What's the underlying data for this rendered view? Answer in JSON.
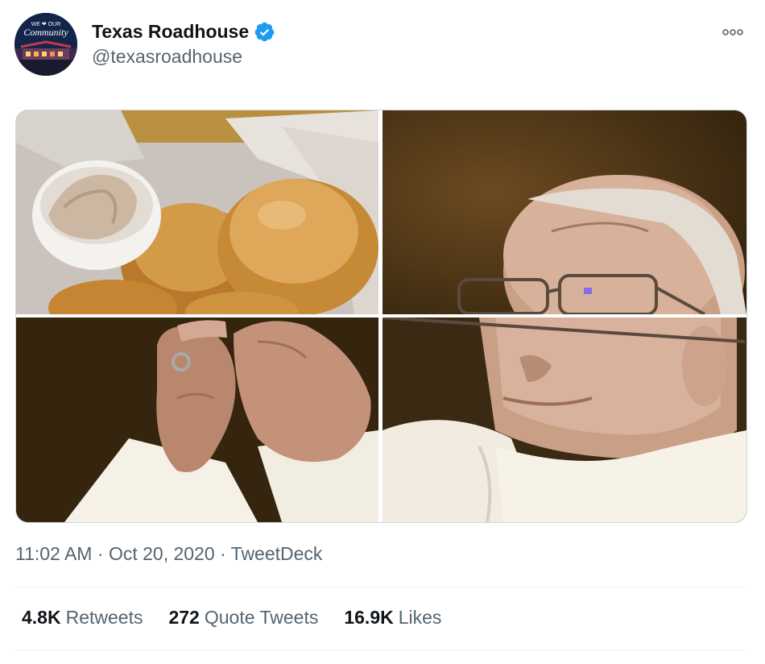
{
  "author": {
    "display_name": "Texas Roadhouse",
    "handle": "@texasroadhouse",
    "verified": true,
    "avatar_text_top": "WE ❤ OUR",
    "avatar_text": "Community"
  },
  "media": [
    {
      "subject": "bread-rolls-with-cinnamon-butter"
    },
    {
      "subject": "pope-upper-face"
    },
    {
      "subject": "hands-holding-communion-host"
    },
    {
      "subject": "pope-lower-face"
    }
  ],
  "meta": {
    "time": "11:02 AM",
    "date": "Oct 20, 2020",
    "separator": "·",
    "source": "TweetDeck"
  },
  "stats": {
    "retweets_count": "4.8K",
    "retweets_label": "Retweets",
    "quotes_count": "272",
    "quotes_label": "Quote Tweets",
    "likes_count": "16.9K",
    "likes_label": "Likes"
  },
  "colors": {
    "text_primary": "#0f1419",
    "text_secondary": "#536471",
    "verified_blue": "#1d9bf0",
    "divider": "#eff3f4"
  },
  "icons": {
    "verified": "verified-badge-icon",
    "more": "more-options-icon"
  }
}
